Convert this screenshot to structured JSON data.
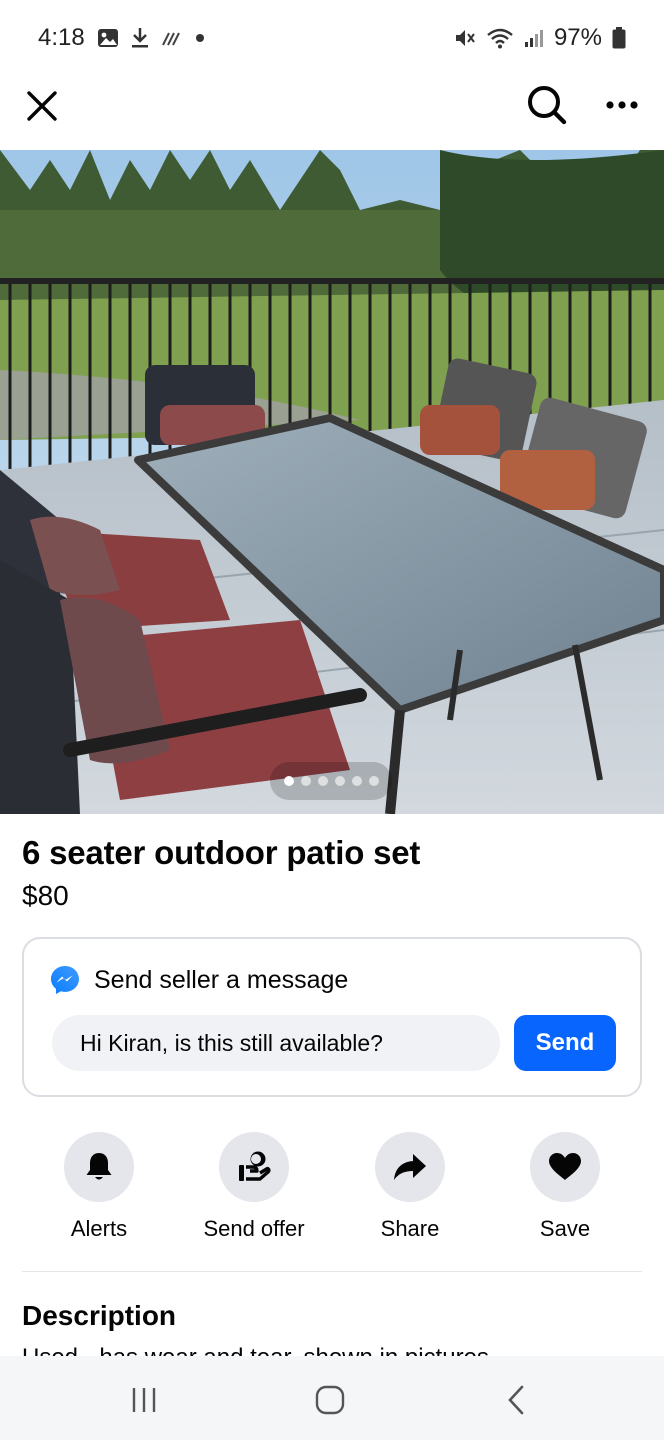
{
  "status_bar": {
    "time": "4:18",
    "battery": "97%"
  },
  "icons": {
    "close": "close-icon",
    "search": "search-icon",
    "more": "more-icon",
    "messenger": "messenger-icon",
    "alerts": "bell-icon",
    "send_offer": "offer-icon",
    "share": "share-arrow-icon",
    "save": "heart-icon"
  },
  "listing": {
    "title": "6 seater outdoor patio set",
    "price": "$80",
    "photo_count": 6,
    "active_photo": 1
  },
  "message_card": {
    "header": "Send seller a message",
    "input_value": "Hi Kiran, is this still available?",
    "send_label": "Send"
  },
  "actions": [
    {
      "label": "Alerts"
    },
    {
      "label": "Send offer"
    },
    {
      "label": "Share"
    },
    {
      "label": "Save"
    }
  ],
  "description": {
    "heading": "Description",
    "text": "Used - has wear and tear, shown in pictures"
  },
  "colors": {
    "accent": "#0866ff",
    "action_bg": "#e4e6eb",
    "input_bg": "#f0f2f5"
  }
}
